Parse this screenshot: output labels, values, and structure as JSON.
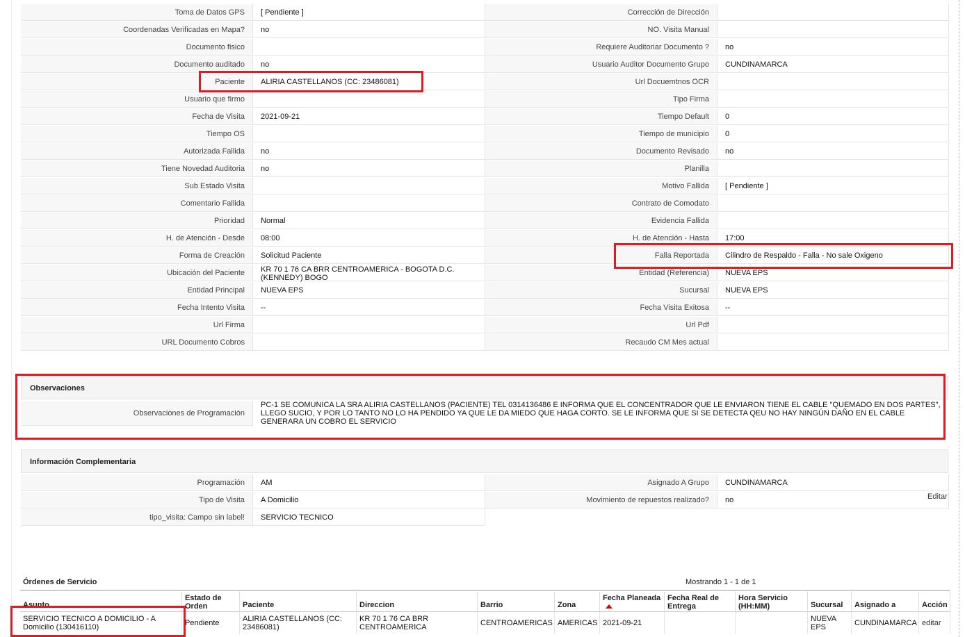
{
  "details": {
    "rows": [
      {
        "l_label": "Toma de Datos GPS",
        "l_value": "[ Pendiente ]",
        "r_label": "Corrección de Dirección",
        "r_value": ""
      },
      {
        "l_label": "Coordenadas Verificadas en Mapa?",
        "l_value": " no",
        "r_label": "NO. Visita Manual",
        "r_value": ""
      },
      {
        "l_label": "Documento fisico",
        "l_value": "",
        "r_label": "Requiere Auditoriar Documento ?",
        "r_value": " no"
      },
      {
        "l_label": "Documento auditado",
        "l_value": " no",
        "r_label": "Usuario Auditor Documento Grupo",
        "r_value": "CUNDINAMARCA"
      },
      {
        "l_label": "Paciente",
        "l_value": "ALIRIA CASTELLANOS (CC: 23486081)",
        "r_label": "Url Docuemtnos OCR",
        "r_value": ""
      },
      {
        "l_label": "Usuario que firmo",
        "l_value": "",
        "r_label": "Tipo Firma",
        "r_value": ""
      },
      {
        "l_label": "Fecha de Visita",
        "l_value": " 2021-09-21",
        "r_label": "Tiempo Default",
        "r_value": "0"
      },
      {
        "l_label": "Tiempo OS",
        "l_value": "",
        "r_label": "Tiempo de municipio",
        "r_value": "0"
      },
      {
        "l_label": "Autorizada Fallida",
        "l_value": " no",
        "r_label": "Documento Revisado",
        "r_value": " no"
      },
      {
        "l_label": "Tiene Novedad Auditoria",
        "l_value": " no",
        "r_label": "Planilla",
        "r_value": ""
      },
      {
        "l_label": "Sub Estado Visita",
        "l_value": "",
        "r_label": "Motivo Fallida",
        "r_value": "[ Pendiente ]"
      },
      {
        "l_label": "Comentario Fallida",
        "l_value": "",
        "r_label": "Contrato de Comodato",
        "r_value": ""
      },
      {
        "l_label": "Prioridad",
        "l_value": "Normal",
        "r_label": "Evidencia Fallida",
        "r_value": ""
      },
      {
        "l_label": "H. de Atención - Desde",
        "l_value": "08:00",
        "r_label": "H. de Atención - Hasta",
        "r_value": "17:00"
      },
      {
        "l_label": "Forma de Creación",
        "l_value": "Solicitud Paciente",
        "r_label": "Falla Reportada",
        "r_value": "Cilindro de Respaldo - Falla - No sale Oxigeno"
      },
      {
        "l_label": "Ubicación del Paciente",
        "l_value": "KR 70 1 76 CA BRR CENTROAMERICA - BOGOTA D.C. (KENNEDY) BOGO",
        "r_label": "Entidad (Referencia)",
        "r_value": "NUEVA EPS"
      },
      {
        "l_label": "Entidad Principal",
        "l_value": "NUEVA EPS",
        "r_label": "Sucursal",
        "r_value": "NUEVA EPS"
      },
      {
        "l_label": "Fecha Intento Visita",
        "l_value": " --",
        "r_label": "Fecha Visita Exitosa",
        "r_value": " --"
      },
      {
        "l_label": "Url Firma",
        "l_value": "",
        "r_label": "Url Pdf",
        "r_value": ""
      },
      {
        "l_label": "URL Documento Cobros",
        "l_value": "",
        "r_label": "Recaudo CM Mes actual",
        "r_value": ""
      }
    ]
  },
  "observaciones": {
    "title": "Observaciones",
    "label": "Observaciones de Programación",
    "text": "  PC-1 SE COMUNICA LA SRA ALIRIA CASTELLANOS (PACIENTE) TEL 0314136486 E INFORMA QUE EL CONCENTRADOR QUE LE ENVIARON TIENE EL CABLE \"QUEMADO EN DOS PARTES\", LLEGO SUCIO, Y POR LO TANTO NO LO HA PENDIDO YA QUE LE DA MIEDO QUE HAGA CORTO. SE LE INFORMA QUE SI SE DETECTA QEU NO HAY NINGÚN DAÑO EN EL CABLE GENERARA UN COBRO EL SERVICIO"
  },
  "complementaria": {
    "title": "Información Complementaria",
    "rows": [
      {
        "l_label": "Programación",
        "l_value": "AM",
        "r_label": "Asignado A Grupo",
        "r_value": "CUNDINAMARCA"
      },
      {
        "l_label": "Tipo de Visita",
        "l_value": "A Domicilio",
        "r_label": "Movimiento de repuestos realizado?",
        "r_value": " no"
      },
      {
        "l_label": "tipo_visita: Campo sin label!",
        "l_value": "SERVICIO TECNICO"
      }
    ],
    "edit_label": "Editar"
  },
  "orders": {
    "title": "Órdenes de Servicio",
    "count_text": "Mostrando 1 - 1 de 1",
    "headers": [
      "Asunto",
      "Estado de Orden",
      "Paciente",
      "Direccion",
      "Barrio",
      "Zona",
      "Fecha Planeada",
      "Fecha Real de Entrega",
      "Hora Servicio (HH:MM)",
      "Sucursal",
      "Asignado a",
      "Acción"
    ],
    "row": {
      "asunto": "SERVICIO TECNICO A DOMICILIO - A Domicilio (130416110)",
      "estado": "Pendiente",
      "paciente": "ALIRIA CASTELLANOS (CC: 23486081)",
      "direccion": "KR 70 1 76 CA BRR CENTROAMERICA",
      "barrio": "CENTROAMERICAS",
      "zona": "AMERICAS",
      "fecha_planeada": "2021-09-21",
      "fecha_real": "",
      "hora": "",
      "sucursal": "NUEVA EPS",
      "asignado": "CUNDINAMARCA",
      "accion": "editar"
    }
  },
  "colors": {
    "highlight": "#e01b24",
    "label_bg": "#f7f7f7",
    "sort_arrow": "#dd0000"
  }
}
